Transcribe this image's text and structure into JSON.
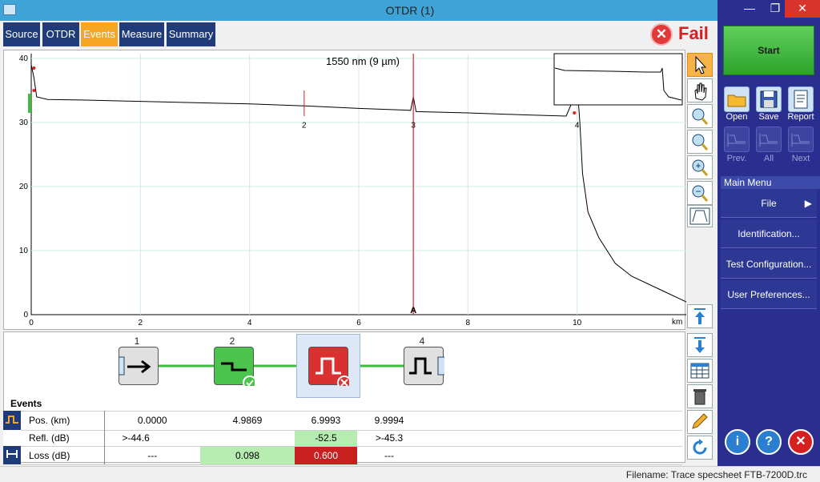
{
  "window": {
    "title": "OTDR (1)",
    "minimize": "—",
    "restore": "❐",
    "close": "✕"
  },
  "tabs": [
    {
      "label": "Source",
      "active": false
    },
    {
      "label": "OTDR",
      "active": false
    },
    {
      "label": "Events",
      "active": true
    },
    {
      "label": "Measure",
      "active": false
    },
    {
      "label": "Summary",
      "active": false
    }
  ],
  "status": {
    "fail_label": "Fail",
    "fail_icon": "✕"
  },
  "chart": {
    "wavelength_label": "1550 nm (9 µm)",
    "x_unit": "km",
    "marker_label": "A"
  },
  "chart_data": {
    "type": "line",
    "xlim": [
      0,
      12
    ],
    "ylim": [
      0,
      40
    ],
    "x_ticks": [
      "0",
      "2",
      "4",
      "6",
      "8",
      "10"
    ],
    "y_ticks": [
      "0",
      "10",
      "20",
      "30",
      "40"
    ],
    "x_unit": "km",
    "grid": true,
    "marker_a_km": 7.0,
    "event_labels": [
      {
        "label": "2",
        "km": 5.0
      },
      {
        "label": "3",
        "km": 7.0
      },
      {
        "label": "4",
        "km": 10.0
      }
    ],
    "series": [
      {
        "x": [
          0,
          0.05,
          0.1,
          0.3,
          1,
          2,
          3,
          4,
          5,
          6,
          6.95,
          7.0,
          7.05,
          8,
          9,
          9.8,
          9.95,
          10.0,
          10.05,
          10.1,
          10.2,
          10.4,
          10.7,
          11.0,
          11.5,
          12
        ],
        "y": [
          39,
          37,
          34,
          33.6,
          33.5,
          33.3,
          33.1,
          32.9,
          32.6,
          32.2,
          31.9,
          34,
          31.7,
          31.5,
          31.2,
          31.0,
          34,
          36,
          30,
          22,
          16,
          12,
          8,
          6,
          4,
          2
        ]
      }
    ]
  },
  "events": {
    "header": "Events",
    "columns": [
      "1",
      "2",
      "3",
      "4"
    ],
    "rows": [
      {
        "label": "Pos. (km)",
        "values": [
          "0.0000",
          "4.9869",
          "6.9993",
          "9.9994"
        ]
      },
      {
        "label": "Refl. (dB)",
        "values": [
          ">-44.6",
          "",
          "-52.5",
          ">-45.3"
        ]
      },
      {
        "label": "Loss (dB)",
        "values": [
          "---",
          "0.098",
          "0.600",
          "---"
        ]
      }
    ],
    "pass_color": "#b6ecb0",
    "fail_color": "#c8201f"
  },
  "sidepanel": {
    "start": "Start",
    "open": "Open",
    "save": "Save",
    "report": "Report",
    "prev": "Prev.",
    "all": "All",
    "next": "Next",
    "main_menu": "Main Menu",
    "menu_items": [
      "File",
      "Identification...",
      "Test Configuration...",
      "User Preferences..."
    ],
    "file_arrow": "▶",
    "info": "i",
    "help": "?",
    "exit": "✕"
  },
  "statusbar": {
    "filename": "Filename: Trace specsheet FTB-7200D.trc"
  }
}
